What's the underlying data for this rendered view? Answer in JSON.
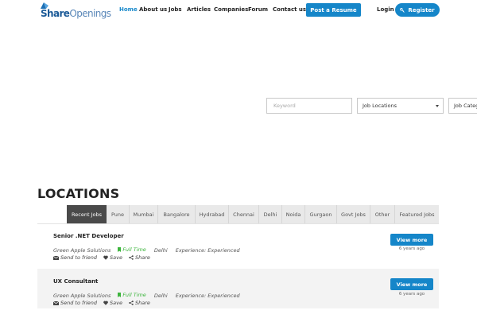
{
  "brand": {
    "part1": "Share",
    "part2": "Openings"
  },
  "nav": {
    "items": [
      {
        "label": "Home",
        "active": true
      },
      {
        "label": "About us"
      },
      {
        "label": "Jobs"
      },
      {
        "label": "Articles"
      },
      {
        "label": "Companies"
      },
      {
        "label": "Forum"
      },
      {
        "label": "Contact us"
      }
    ],
    "post_resume": "Post a Resume",
    "login": "Login",
    "register": "Register"
  },
  "search": {
    "keyword_placeholder": "Keyword",
    "location_value": "Job Locations",
    "category_value": "Job Category"
  },
  "locations": {
    "title": "LOCATIONS",
    "tabs": [
      "Recent Jobs",
      "Pune",
      "Mumbai",
      "Bangalore",
      "Hydrabad",
      "Chennai",
      "Delhi",
      "Noida",
      "Gurgaon",
      "Govt Jobs",
      "Other",
      "Featured Jobs"
    ],
    "active_tab": "Recent Jobs"
  },
  "jobs": [
    {
      "title": "Senior .NET Developer",
      "company": "Green Apple Solutions",
      "type": "Full Time",
      "location": "Delhi",
      "experience": "Experience: Experienced",
      "send": "Send to friend",
      "save": "Save",
      "share": "Share",
      "button": "View more",
      "ago": "6 years ago"
    },
    {
      "title": "UX Consultant",
      "company": "Green Apple Solutions",
      "type": "Full Time",
      "location": "Delhi",
      "experience": "Experience: Experienced",
      "send": "Send to friend",
      "save": "Save",
      "share": "Share",
      "button": "View more",
      "ago": "6 years ago"
    }
  ],
  "colors": {
    "accent": "#1586c9",
    "nav_active": "#1a8acb",
    "full_time": "#3cb43c",
    "tab_active": "#4a4a4a"
  }
}
